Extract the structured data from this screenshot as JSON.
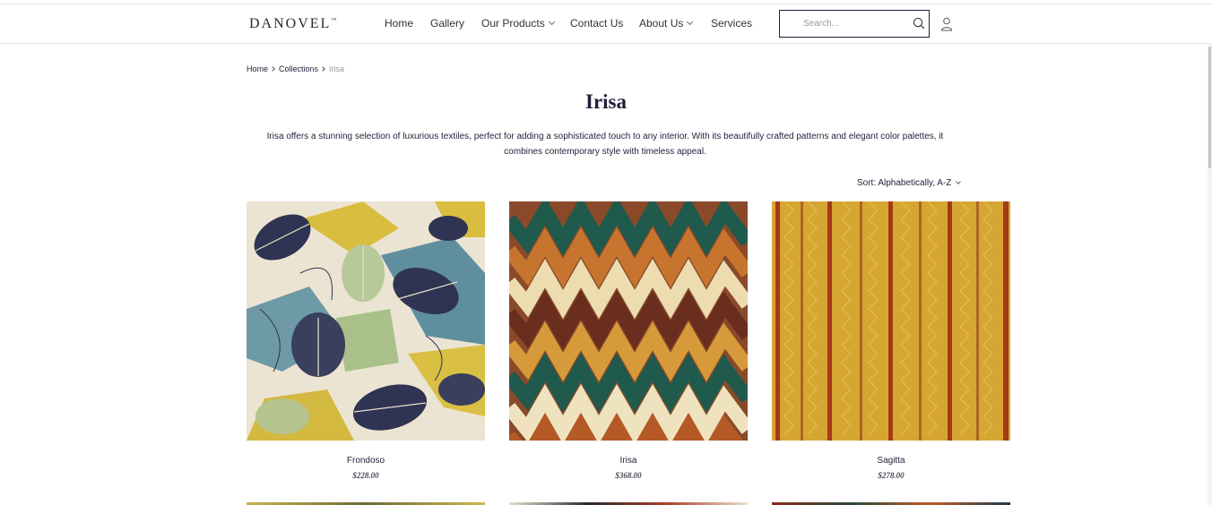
{
  "brand": {
    "logo": "DANOVEL",
    "trademark": "™"
  },
  "nav": {
    "home": "Home",
    "gallery": "Gallery",
    "products": "Our Products",
    "contact": "Contact Us",
    "about": "About Us",
    "services": "Services"
  },
  "search": {
    "placeholder": "Search..."
  },
  "breadcrumb": {
    "home": "Home",
    "collections": "Collections",
    "current": "Irisa"
  },
  "collection": {
    "title": "Irisa",
    "description": "Irisa offers a stunning selection of luxurious textiles, perfect for adding a sophisticated touch to any interior. With its beautifully crafted patterns and elegant color palettes, it combines contemporary style with timeless appeal."
  },
  "sort": {
    "label": "Sort: Alphabetically, A-Z"
  },
  "products": [
    {
      "name": "Frondoso",
      "price": "$228.00"
    },
    {
      "name": "Irisa",
      "price": "$368.00"
    },
    {
      "name": "Sagitta",
      "price": "$278.00"
    }
  ],
  "colors": {
    "accent": "#1f1f3a",
    "border": "#e6e6e6"
  },
  "icons": [
    "search-icon",
    "user-icon",
    "chevron-down-icon",
    "chevron-right-icon"
  ]
}
